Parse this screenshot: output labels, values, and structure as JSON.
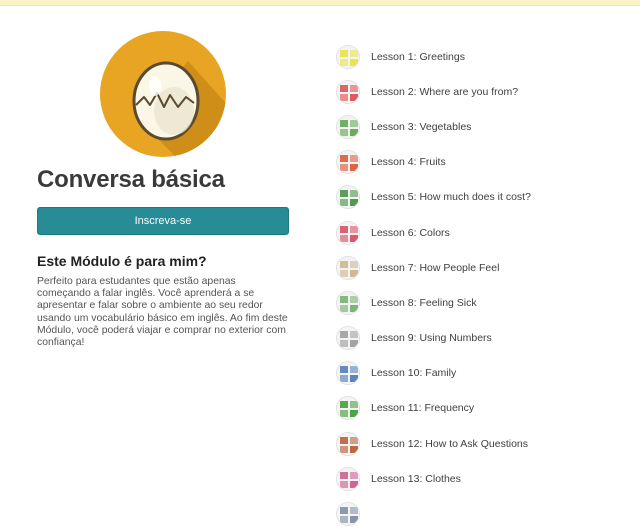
{
  "course": {
    "title": "Conversa básica",
    "enroll_label": "Inscreva-se",
    "about_heading": "Este Módulo é para mim?",
    "about_text": "Perfeito para estudantes que estão apenas começando a falar inglês. Você aprenderá a se apresentar e falar sobre o ambiente ao seu redor usando um vocabulário básico em inglês. Ao fim deste Módulo, você poderá viajar e comprar no exterior com confiança!",
    "logo_icon": "cracked-egg-icon",
    "colors": {
      "logo_circle": "#e8a524",
      "logo_shadow": "#c98a16",
      "button": "#278c95",
      "top_strip": "#fbf1c6"
    }
  },
  "lessons": [
    {
      "label": "Lesson 1: Greetings",
      "icon": "greetings-thumbnail",
      "color": "#e9e23a"
    },
    {
      "label": "Lesson 2: Where are you from?",
      "icon": "world-flags-thumbnail",
      "color": "#d84b4b"
    },
    {
      "label": "Lesson 3: Vegetables",
      "icon": "vegetables-thumbnail",
      "color": "#5aa54a"
    },
    {
      "label": "Lesson 4: Fruits",
      "icon": "fruits-thumbnail",
      "color": "#d9532f"
    },
    {
      "label": "Lesson 5: How much does it cost?",
      "icon": "dollar-sign-thumbnail",
      "color": "#3f8f3f"
    },
    {
      "label": "Lesson 6: Colors",
      "icon": "color-swatches-thumbnail",
      "color": "#d8475e"
    },
    {
      "label": "Lesson 7: How People Feel",
      "icon": "faces-thumbnail",
      "color": "#c9b48a"
    },
    {
      "label": "Lesson 8: Feeling Sick",
      "icon": "sick-people-thumbnail",
      "color": "#6fae6a"
    },
    {
      "label": "Lesson 9: Using Numbers",
      "icon": "numbers-thumbnail",
      "color": "#9a9a9a"
    },
    {
      "label": "Lesson 10: Family",
      "icon": "family-thumbnail",
      "color": "#4a78b8"
    },
    {
      "label": "Lesson 11: Frequency",
      "icon": "frequency-thumbnail",
      "color": "#3c9a35"
    },
    {
      "label": "Lesson 12: How to Ask Questions",
      "icon": "question-marks-thumbnail",
      "color": "#b8572b"
    },
    {
      "label": "Lesson 13: Clothes",
      "icon": "clothes-thumbnail",
      "color": "#c75a8a"
    },
    {
      "label": "",
      "icon": "lesson-thumbnail",
      "color": "#7a8aa0"
    }
  ]
}
